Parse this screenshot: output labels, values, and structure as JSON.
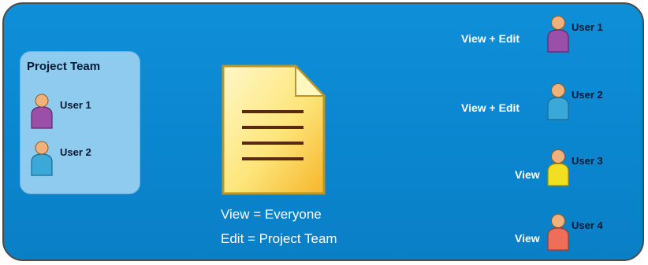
{
  "team": {
    "title": "Project Team",
    "users": [
      {
        "label": "User 1",
        "shirt": "#9b4fa8"
      },
      {
        "label": "User 2",
        "shirt": "#3aa9d9"
      }
    ]
  },
  "document": {
    "icon": "document-icon",
    "lines": [
      "View = Everyone",
      "Edit = Project Team"
    ],
    "colors": {
      "page": "#fdf1a8",
      "border": "#c09420",
      "lines": "#5a2a10"
    }
  },
  "access": [
    {
      "permission": "View + Edit",
      "user": "User 1",
      "shirt": "#9b4fa8"
    },
    {
      "permission": "View + Edit",
      "user": "User 2",
      "shirt": "#3aa9d9"
    },
    {
      "permission": "View",
      "user": "User 3",
      "shirt": "#f3df22"
    },
    {
      "permission": "View",
      "user": "User 4",
      "shirt": "#ee6e5a"
    }
  ],
  "colors": {
    "background": "#0a86cf",
    "team_box": "#8ecbee",
    "text": "#ffffff"
  }
}
